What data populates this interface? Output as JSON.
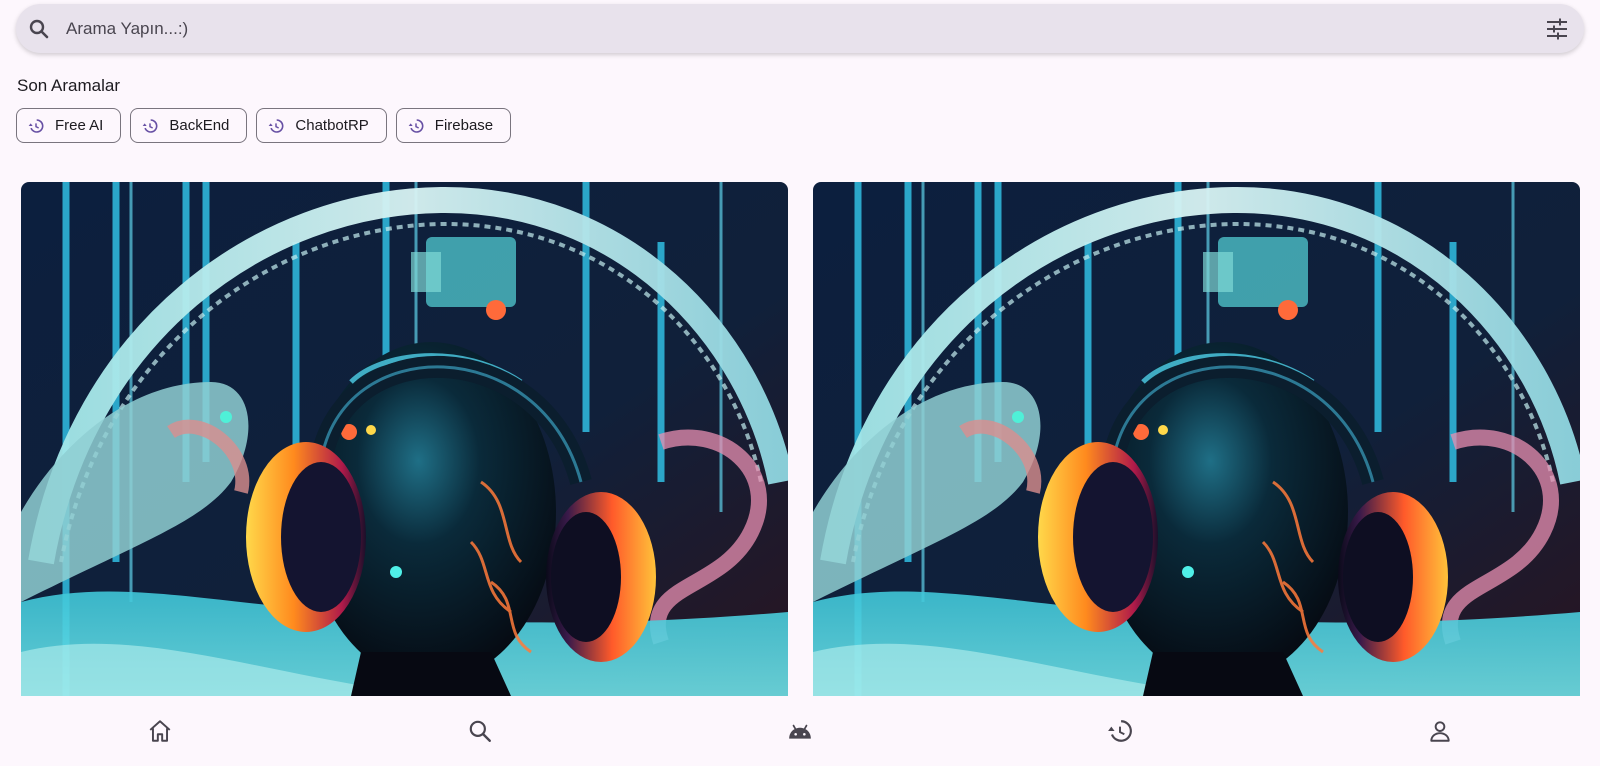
{
  "search": {
    "placeholder": "Arama Yapın...:)",
    "value": "",
    "leading_icon": "search-icon",
    "trailing_icon": "tune-icon"
  },
  "recent": {
    "title": "Son Aramalar",
    "chips": [
      {
        "label": "Free AI",
        "icon": "history-icon"
      },
      {
        "label": "BackEnd",
        "icon": "history-icon"
      },
      {
        "label": "ChatbotRP",
        "icon": "history-icon"
      },
      {
        "label": "Firebase",
        "icon": "history-icon"
      }
    ]
  },
  "gallery": {
    "cards": [
      {
        "image": "ai-art-headphones-robot"
      },
      {
        "image": "ai-art-headphones-robot"
      }
    ]
  },
  "bottom_nav": {
    "items": [
      {
        "icon": "home-icon"
      },
      {
        "icon": "search-icon"
      },
      {
        "icon": "android-icon"
      },
      {
        "icon": "history-icon"
      },
      {
        "icon": "person-icon"
      }
    ]
  },
  "colors": {
    "background": "#fdf7fd",
    "search_bar": "#e8e2ec",
    "chip_border": "#79747e",
    "chip_icon": "#6750a4",
    "text": "#1d1b20"
  }
}
